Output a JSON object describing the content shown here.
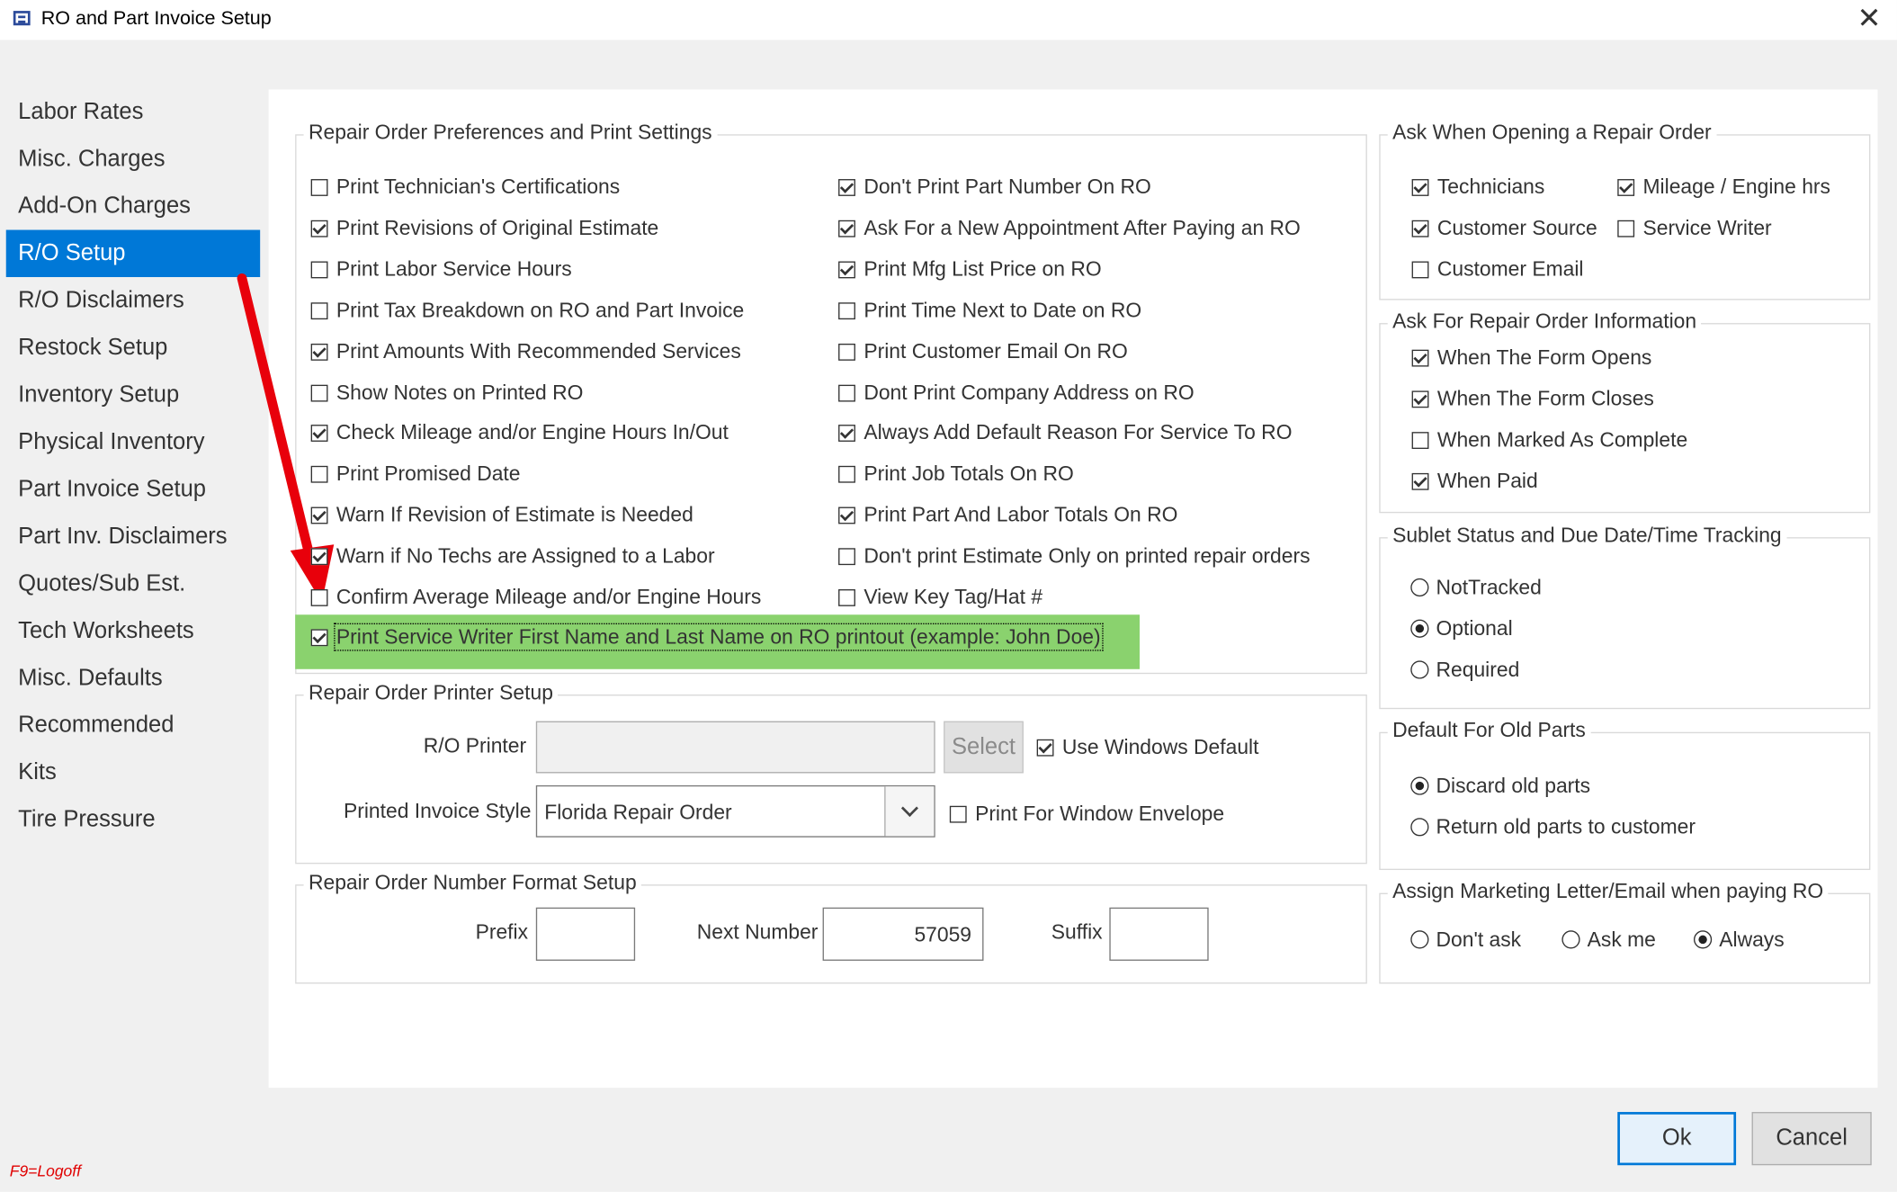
{
  "window": {
    "title": "RO and Part Invoice Setup",
    "close_glyph": "✕"
  },
  "nav": {
    "items": [
      "Labor Rates",
      "Misc. Charges",
      "Add-On Charges",
      "R/O Setup",
      "R/O Disclaimers",
      "Restock Setup",
      "Inventory Setup",
      "Physical Inventory",
      "Part Invoice Setup",
      "Part Inv. Disclaimers",
      "Quotes/Sub Est.",
      "Tech Worksheets",
      "Misc. Defaults",
      "Recommended",
      "Kits",
      "Tire Pressure"
    ],
    "active": "R/O Setup"
  },
  "prefs": {
    "legend": "Repair Order Preferences and Print Settings",
    "left": [
      {
        "label": "Print Technician's Certifications",
        "checked": false
      },
      {
        "label": "Print Revisions of Original Estimate",
        "checked": true
      },
      {
        "label": "Print Labor Service Hours",
        "checked": false
      },
      {
        "label": "Print Tax Breakdown on RO and Part Invoice",
        "checked": false
      },
      {
        "label": "Print Amounts With Recommended Services",
        "checked": true
      },
      {
        "label": "Show Notes on Printed RO",
        "checked": false
      },
      {
        "label": "Check Mileage and/or Engine Hours In/Out",
        "checked": true
      },
      {
        "label": "Print Promised Date",
        "checked": false
      },
      {
        "label": "Warn If Revision of Estimate is Needed",
        "checked": true
      },
      {
        "label": "Warn if No Techs are Assigned to a Labor",
        "checked": true
      },
      {
        "label": "Confirm Average Mileage and/or Engine Hours",
        "checked": false
      }
    ],
    "right": [
      {
        "label": "Don't Print Part Number On RO",
        "checked": true
      },
      {
        "label": "Ask For a New Appointment After Paying an RO",
        "checked": true
      },
      {
        "label": "Print Mfg List Price on RO",
        "checked": true
      },
      {
        "label": "Print Time Next to Date on RO",
        "checked": false
      },
      {
        "label": "Print Customer Email On RO",
        "checked": false
      },
      {
        "label": "Dont Print Company Address on RO",
        "checked": false
      },
      {
        "label": "Always Add Default Reason For Service To RO",
        "checked": true
      },
      {
        "label": "Print Job Totals On RO",
        "checked": false
      },
      {
        "label": "Print Part And Labor Totals On RO",
        "checked": true
      },
      {
        "label": "Don't print Estimate Only on printed repair orders",
        "checked": false
      },
      {
        "label": "View Key Tag/Hat #",
        "checked": false
      }
    ],
    "highlighted": {
      "label": "Print Service Writer First Name and Last Name on RO printout (example: John Doe)",
      "checked": true
    }
  },
  "printer": {
    "legend": "Repair Order Printer Setup",
    "ro_printer_label": "R/O Printer",
    "ro_printer_value": "",
    "select_label": "Select",
    "use_windows_default": {
      "label": "Use Windows Default",
      "checked": true
    },
    "style_label": "Printed Invoice Style",
    "style_value": "Florida Repair Order",
    "window_envelope": {
      "label": "Print For Window Envelope",
      "checked": false
    }
  },
  "number": {
    "legend": "Repair Order Number Format Setup",
    "prefix_label": "Prefix",
    "prefix_value": "",
    "next_label": "Next Number",
    "next_value": "57059",
    "suffix_label": "Suffix",
    "suffix_value": ""
  },
  "ask_opening": {
    "legend": "Ask When Opening a Repair Order",
    "items": [
      {
        "label": "Technicians",
        "checked": true
      },
      {
        "label": "Mileage / Engine hrs",
        "checked": true
      },
      {
        "label": "Customer Source",
        "checked": true
      },
      {
        "label": "Service Writer",
        "checked": false
      },
      {
        "label": "Customer Email",
        "checked": false
      }
    ]
  },
  "ask_info": {
    "legend": "Ask For Repair Order Information",
    "items": [
      {
        "label": "When The Form Opens",
        "checked": true
      },
      {
        "label": "When The Form Closes",
        "checked": true
      },
      {
        "label": "When Marked As Complete",
        "checked": false
      },
      {
        "label": "When Paid",
        "checked": true
      }
    ]
  },
  "sublet": {
    "legend": "Sublet Status and Due Date/Time Tracking",
    "options": [
      {
        "label": "NotTracked",
        "selected": false
      },
      {
        "label": "Optional",
        "selected": true
      },
      {
        "label": "Required",
        "selected": false
      }
    ]
  },
  "old_parts": {
    "legend": "Default For Old Parts",
    "options": [
      {
        "label": "Discard old parts",
        "selected": true
      },
      {
        "label": "Return old parts to customer",
        "selected": false
      }
    ]
  },
  "marketing": {
    "legend": "Assign Marketing Letter/Email when paying RO",
    "options": [
      {
        "label": "Don't ask",
        "selected": false
      },
      {
        "label": "Ask me",
        "selected": false
      },
      {
        "label": "Always",
        "selected": true
      }
    ]
  },
  "buttons": {
    "ok": "Ok",
    "cancel": "Cancel"
  },
  "footer": {
    "hint": "F9=Logoff"
  },
  "colors": {
    "accent": "#0078d7",
    "highlight": "#8ad26e",
    "arrow": "#e8000b",
    "hint": "#e00000"
  }
}
